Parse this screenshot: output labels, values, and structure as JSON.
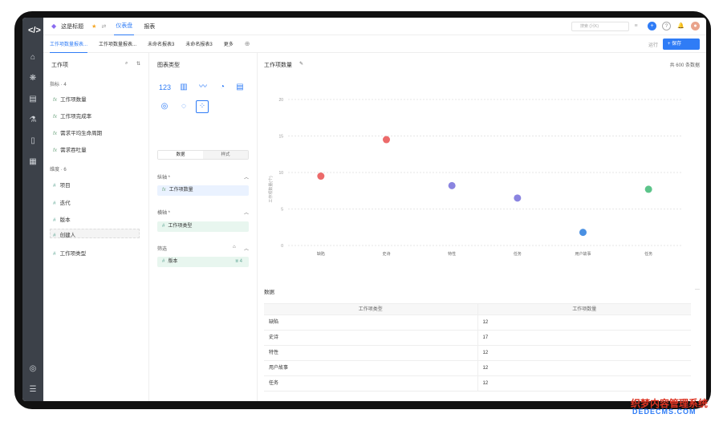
{
  "topbar": {
    "breadcrumb": "这是标题",
    "tabs": [
      "仪表盘",
      "报表"
    ],
    "search_placeholder": "搜索 (⌘K)"
  },
  "report_tabs": [
    "工作项数量报表...",
    "工作项数量报表...",
    "未命名报表3",
    "未命名报表3",
    "更多"
  ],
  "actions": {
    "run": "运行",
    "save": "+ 保存"
  },
  "fields_panel": {
    "title": "工作项",
    "metrics_section": "指标 · 4",
    "metrics": [
      "工作项数量",
      "工作项完成率",
      "需求平均生命周期",
      "需求吞吐量"
    ],
    "dimensions_section": "维度 · 6",
    "dimensions": [
      "项目",
      "迭代",
      "版本",
      "创建人",
      "工作项类型"
    ]
  },
  "chart_config": {
    "title": "图表类型",
    "seg_data": "数据",
    "seg_style": "样式",
    "y_axis_label": "纵轴 *",
    "y_axis_value": "工作项数量",
    "x_axis_label": "横轴 *",
    "x_axis_value": "工作项类型",
    "filter_label": "筛选",
    "filter_value": "版本",
    "filter_count": "4"
  },
  "chart_panel": {
    "title": "工作项数量",
    "count_label": "共 600 条数据",
    "ylabel": "工作项数量(个)"
  },
  "chart_data": {
    "type": "scatter",
    "categories": [
      "缺陷",
      "史诗",
      "特性",
      "任务",
      "用户故事",
      "任务"
    ],
    "values": [
      9.5,
      14.5,
      8.2,
      6.5,
      1.8,
      7.7
    ],
    "colors": [
      "#ec6a6a",
      "#ec6a6a",
      "#8a84e0",
      "#8a84e0",
      "#4a90e2",
      "#5cc48a"
    ],
    "ylim": [
      0,
      20
    ],
    "yticks": [
      "0",
      "5",
      "10",
      "15",
      "20"
    ]
  },
  "data_table": {
    "title": "数据",
    "headers": [
      "工作项类型",
      "工作项数量"
    ],
    "rows": [
      [
        "缺陷",
        "12"
      ],
      [
        "史诗",
        "17"
      ],
      [
        "特性",
        "12"
      ],
      [
        "用户故事",
        "12"
      ],
      [
        "任务",
        "12"
      ]
    ]
  },
  "watermark": {
    "line1": "织梦内容管理系统",
    "line2": "DEDECMS.COM"
  }
}
